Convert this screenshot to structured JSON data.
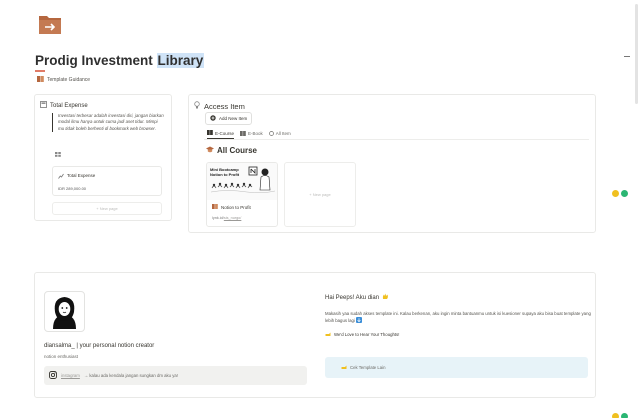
{
  "page": {
    "title_main": "Prodig Investment ",
    "title_highlight": "Library",
    "icon": "folder-arrow-icon",
    "guidance_link": "Template Guidance"
  },
  "total_expense": {
    "heading": "Total Expense",
    "quote": "Investasi terbesar adalah investasi diri, jangan biarkan modal ilmu hanya untuk cuma jadi aset tidur. Mimpi mu tidak boleh berhenti di bookmark web browser.",
    "card_title": "Total Expense",
    "card_value": "IDR 289,000.00",
    "new_page": "+ New page"
  },
  "access_item": {
    "heading": "Access Item",
    "add_button": "Add New Item",
    "tabs": [
      {
        "label": "E-Course",
        "icon": "book-icon",
        "active": true
      },
      {
        "label": "E-Book",
        "icon": "book-icon",
        "active": false
      },
      {
        "label": "All Item",
        "icon": "circle-icon",
        "active": false
      }
    ],
    "section_title": "All Course",
    "course": {
      "cover_text_line1": "Mini Bootcamp",
      "cover_text_line2": "Notion to Profit",
      "name": "Notion to Profit",
      "url_prefix": "lynk.id/",
      "url_link": "sis_nurgo/"
    },
    "new_page": "+ New page"
  },
  "profile": {
    "name": "diansalma_ | your personal notion creator",
    "role": "notion enthusiast",
    "instagram_link": "instagram",
    "instagram_text": "→ kalau ada kendala jangan sungkan dm aku ya!"
  },
  "welcome": {
    "greeting": "Hai Peeps! Aku dian",
    "paragraph": "Makasih yaa sudah akses template ini. Kalau berkenan, aku ingin minta bantuanmu untuk isi kuesioner supaya aku bisa buat template yang lebih bagus lagi",
    "love_text": "We'd Love to Hear Your Thoughts!",
    "callout_text": "Cek Template Lain"
  },
  "colors": {
    "brand_orange": "#b5673f",
    "highlight_blue": "#cfe3f7",
    "callout_blue": "#e7f3f8"
  }
}
